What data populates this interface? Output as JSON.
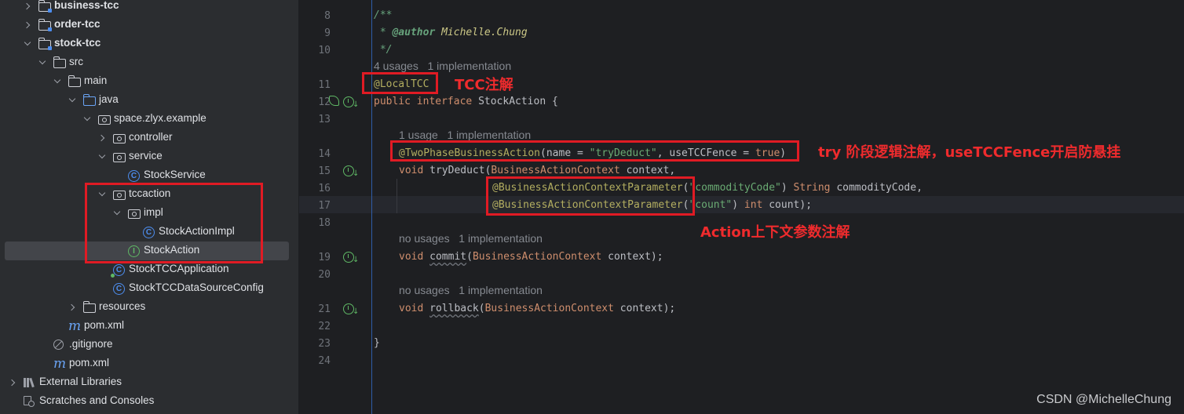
{
  "project_tree": {
    "items": [
      {
        "label": "business-tcc",
        "kind": "module",
        "state": "closed",
        "bold": true
      },
      {
        "label": "order-tcc",
        "kind": "module",
        "state": "closed",
        "bold": true
      },
      {
        "label": "stock-tcc",
        "kind": "module",
        "state": "open",
        "bold": true
      },
      {
        "label": "src",
        "kind": "folder",
        "state": "open"
      },
      {
        "label": "main",
        "kind": "folder",
        "state": "open"
      },
      {
        "label": "java",
        "kind": "source-folder",
        "state": "open"
      },
      {
        "label": "space.zlyx.example",
        "kind": "package",
        "state": "open"
      },
      {
        "label": "controller",
        "kind": "package",
        "state": "closed"
      },
      {
        "label": "service",
        "kind": "package",
        "state": "open"
      },
      {
        "label": "StockService",
        "kind": "class"
      },
      {
        "label": "tccaction",
        "kind": "package",
        "state": "open"
      },
      {
        "label": "impl",
        "kind": "package",
        "state": "open"
      },
      {
        "label": "StockActionImpl",
        "kind": "class"
      },
      {
        "label": "StockAction",
        "kind": "interface",
        "selected": true
      },
      {
        "label": "StockTCCApplication",
        "kind": "app-class"
      },
      {
        "label": "StockTCCDataSourceConfig",
        "kind": "class"
      },
      {
        "label": "resources",
        "kind": "folder",
        "state": "closed"
      },
      {
        "label": "pom.xml",
        "kind": "maven"
      },
      {
        "label": ".gitignore",
        "kind": "ignore"
      },
      {
        "label": "pom.xml",
        "kind": "maven"
      },
      {
        "label": "External Libraries",
        "kind": "libraries",
        "state": "closed"
      },
      {
        "label": "Scratches and Consoles",
        "kind": "scratches"
      }
    ]
  },
  "editor": {
    "line_numbers": [
      "8",
      "9",
      "10",
      "11",
      "12",
      "13",
      "14",
      "15",
      "16",
      "17",
      "18",
      "19",
      "20",
      "21",
      "22",
      "23",
      "24"
    ],
    "hints": {
      "interface": "4 usages   1 implementation",
      "try_deduct": "1 usage   1 implementation",
      "commit": "no usages   1 implementation",
      "rollback": "no usages   1 implementation"
    },
    "tokens": {
      "doc_open": "/**",
      "doc_author_prefix": " * ",
      "doc_author_tag": "@author",
      "doc_author_name": " Michelle.Chung",
      "doc_close": " */",
      "ann_local_tcc": "@LocalTCC",
      "kw_public": "public",
      "kw_interface": " interface ",
      "name_stock_action": "StockAction",
      "brace_open": " {",
      "ann_two_phase": "@TwoPhaseBusinessAction",
      "two_phase_args_a": "(name = ",
      "str_try_deduct": "\"tryDeduct\"",
      "two_phase_args_b": ", useTCCFence = ",
      "kw_true": "true",
      "paren_close": ")",
      "kw_void": "void",
      "method_try_deduct": " tryDeduct(",
      "type_context": "BusinessActionContext",
      "param_context_comma": " context,",
      "ann_param": "@BusinessActionContextParameter",
      "paren_open": "(",
      "str_commodity_code": "\"commodityCode\"",
      "type_string_sp": " String",
      "param_commodity_code": " commodityCode,",
      "str_count": "\"count\"",
      "kw_int_sp": " int",
      "param_count_end": " count);",
      "method_commit": "commit",
      "method_rollback": "rollback",
      "param_context_end": " context);",
      "sp": " ",
      "brace_close": "}"
    }
  },
  "annotations": {
    "tcc_note": "TCC注解",
    "try_note": "try 阶段逻辑注解，useTCCFence开启防悬挂",
    "param_note": "Action上下文参数注解"
  },
  "watermark": "CSDN @MichelleChung",
  "colors": {
    "annotation_red": "#e01b24",
    "keyword": "#cf8e6d",
    "annotation": "#b3ae60",
    "string": "#6aab73"
  }
}
